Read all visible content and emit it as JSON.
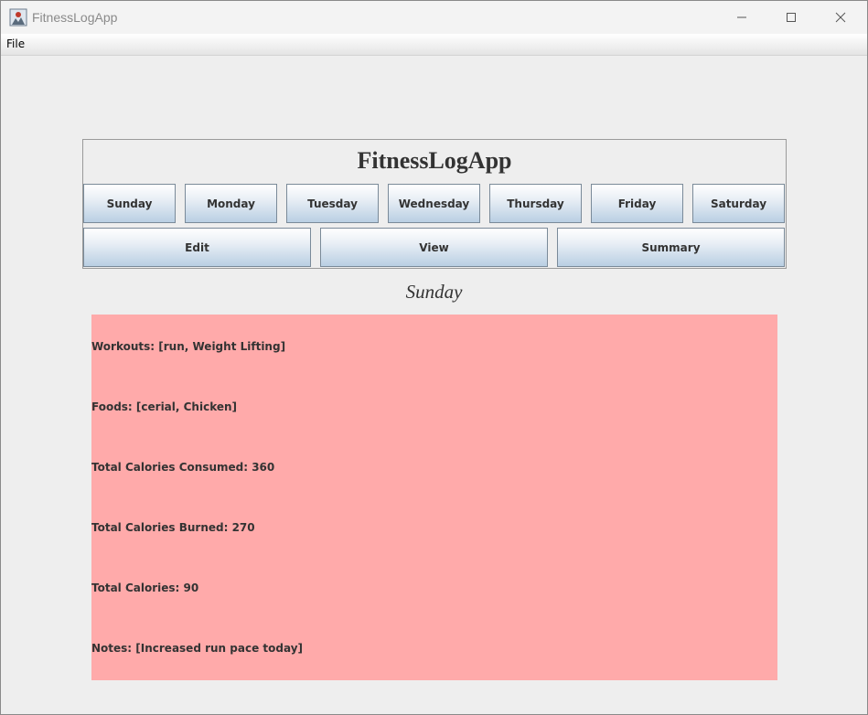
{
  "window": {
    "title": "FitnessLogApp",
    "icon": "java-app-icon"
  },
  "menubar": {
    "file_label": "File"
  },
  "header": {
    "title": "FitnessLogApp"
  },
  "days": [
    "Sunday",
    "Monday",
    "Tuesday",
    "Wednesday",
    "Thursday",
    "Friday",
    "Saturday"
  ],
  "actions": {
    "edit": "Edit",
    "view": "View",
    "summary": "Summary"
  },
  "selected_day": "Sunday",
  "details": {
    "workouts": "Workouts: [run, Weight Lifting]",
    "foods": "Foods: [cerial, Chicken]",
    "calories_consumed": "Total Calories Consumed: 360",
    "calories_burned": "Total Calories Burned: 270",
    "total_calories": "Total Calories: 90",
    "notes": "Notes: [Increased run pace today]"
  },
  "colors": {
    "details_background": "#ffaaaa",
    "button_gradient_bottom": "#b9cfe3"
  }
}
